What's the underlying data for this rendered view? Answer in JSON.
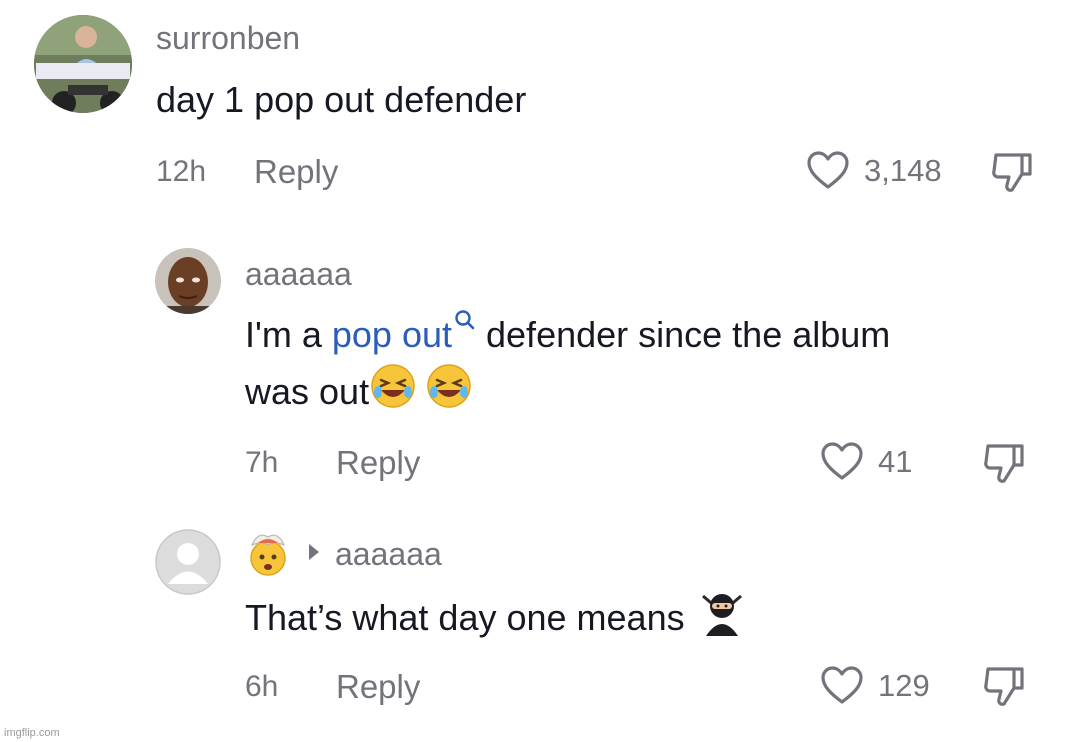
{
  "comments": [
    {
      "username": "surronben",
      "text": "day 1 pop out defender",
      "time": "12h",
      "reply_label": "Reply",
      "likes": "3,148"
    },
    {
      "username": "aaaaaa",
      "text_before_link": "I'm a ",
      "link_text": "pop out",
      "text_after_link": " defender since the album",
      "text_line2": "was out",
      "time": "7h",
      "reply_label": "Reply",
      "likes": "41"
    },
    {
      "reply_to": "aaaaaa",
      "text": "That’s what day one means",
      "time": "6h",
      "reply_label": "Reply",
      "likes": "129"
    }
  ],
  "watermark": "imgflip.com",
  "colors": {
    "secondary_text": "#73747b",
    "primary_text": "#161823",
    "link": "#2b5db9"
  },
  "icons": [
    "heart-icon",
    "dislike-icon",
    "search-icon",
    "play-arrow-icon",
    "laughing-emoji",
    "exploding-head-emoji",
    "ninja-emoji"
  ]
}
